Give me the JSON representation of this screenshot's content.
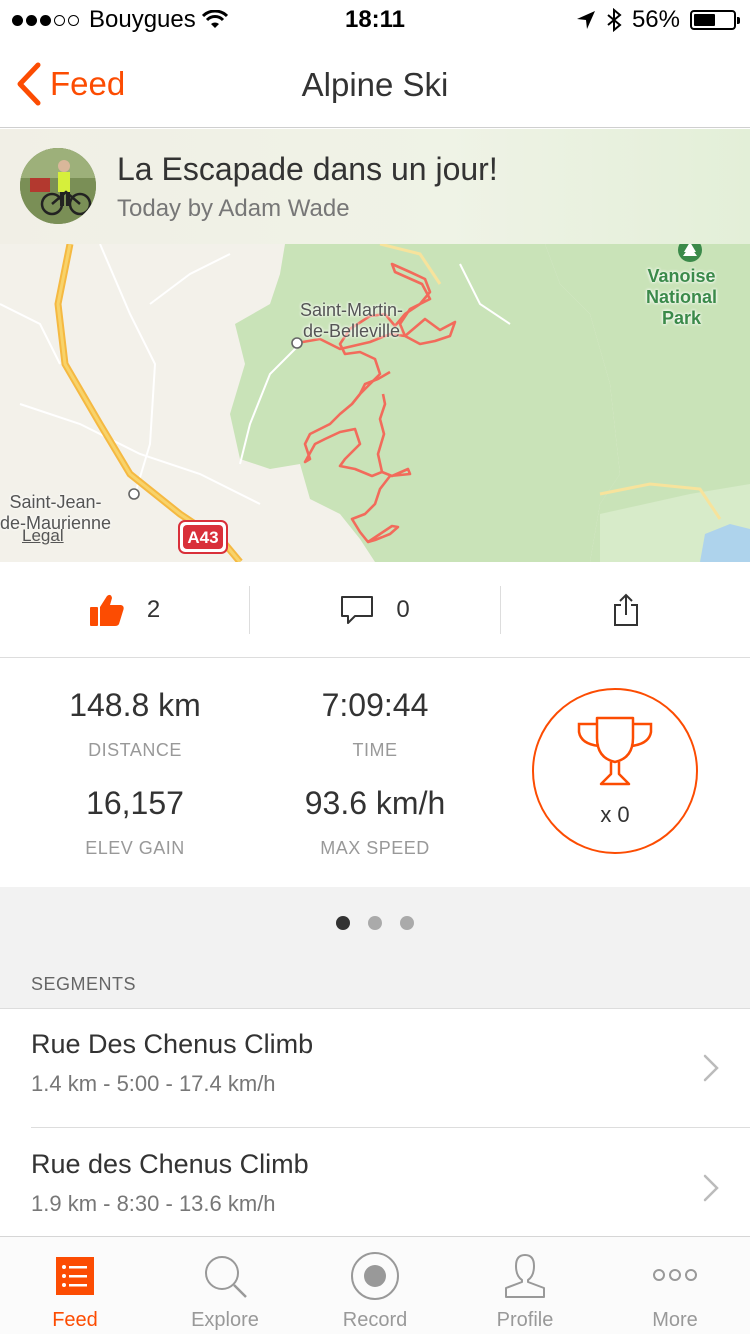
{
  "status_bar": {
    "carrier": "Bouygues",
    "time": "18:11",
    "battery": "56%",
    "battery_level": 0.56
  },
  "nav": {
    "back_label": "Feed",
    "title": "Alpine Ski"
  },
  "activity": {
    "title": "La Escapade dans un jour!",
    "subtitle": "Today by Adam Wade"
  },
  "map": {
    "labels": {
      "saint_martin_1": "Saint-Martin-",
      "saint_martin_2": "de-Belleville",
      "vanoise_1": "Vanoise",
      "vanoise_2": "National",
      "vanoise_3": "Park",
      "saint_jean_1": "Saint-Jean-",
      "saint_jean_2": "de-Maurienne",
      "legal": "Legal",
      "highway": "A43"
    },
    "colors": {
      "route": "#f26b5b",
      "forest": "#c9e3b8",
      "land": "#f3f1ea",
      "road": "#f7c94b",
      "water": "#aed3ec"
    }
  },
  "actions": {
    "kudos_count": "2",
    "comment_count": "0"
  },
  "stats": {
    "distance_value": "148.8 km",
    "distance_label": "DISTANCE",
    "time_value": "7:09:44",
    "time_label": "TIME",
    "elev_value": "16,157",
    "elev_label": "ELEV GAIN",
    "speed_value": "93.6 km/h",
    "speed_label": "MAX SPEED",
    "trophy_count": "x 0"
  },
  "pager": {
    "pages": 3,
    "active": 0
  },
  "segments_header": "SEGMENTS",
  "segments": [
    {
      "name": "Rue Des Chenus Climb",
      "meta": "1.4 km - 5:00 - 17.4 km/h"
    },
    {
      "name": "Rue des Chenus Climb",
      "meta": "1.9 km - 8:30 - 13.6 km/h"
    }
  ],
  "tabs": [
    {
      "label": "Feed",
      "icon": "feed-icon",
      "active": true
    },
    {
      "label": "Explore",
      "icon": "search-icon",
      "active": false
    },
    {
      "label": "Record",
      "icon": "record-icon",
      "active": false
    },
    {
      "label": "Profile",
      "icon": "profile-icon",
      "active": false
    },
    {
      "label": "More",
      "icon": "more-icon",
      "active": false
    }
  ],
  "colors": {
    "accent": "#fc4c02"
  }
}
